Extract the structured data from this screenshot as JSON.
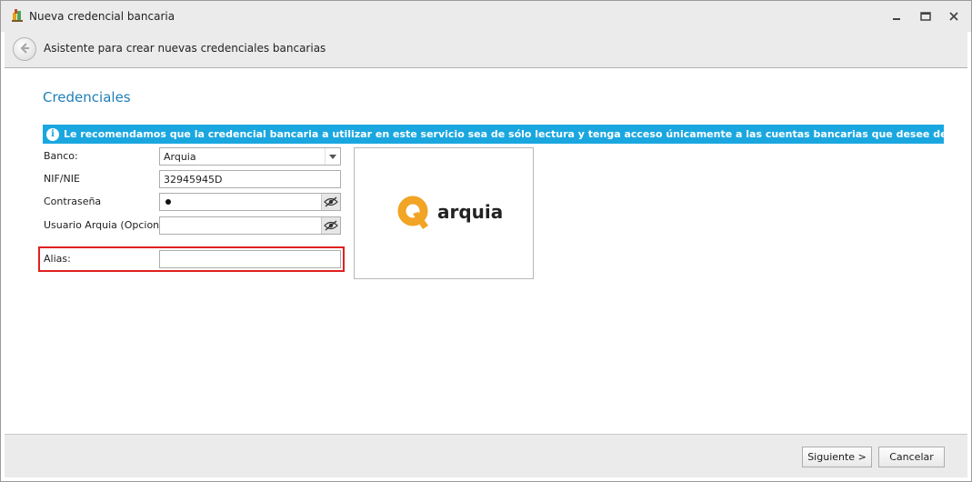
{
  "window": {
    "title": "Nueva credencial bancaria"
  },
  "header": {
    "title": "Asistente para crear nuevas credenciales bancarias"
  },
  "section": {
    "title": "Credenciales"
  },
  "banner": {
    "text": "Le recomendamos que la credencial bancaria a utilizar en este servicio sea de sólo lectura y tenga acceso únicamente a las cuentas bancarias que desee descargar.",
    "color": "#1aa7e0"
  },
  "form": {
    "bank_label": "Banco:",
    "bank_value": "Arquia",
    "nif_label": "NIF/NIE",
    "nif_value": "32945945D",
    "password_label": "Contraseña",
    "password_masked_count": 1,
    "user_label": "Usuario Arquia (Opcional)",
    "user_value": "",
    "alias_label": "Alias:",
    "alias_value": ""
  },
  "logo": {
    "text": "arquia",
    "accent": "#f2a424"
  },
  "footer": {
    "next_label": "Siguiente >",
    "cancel_label": "Cancelar"
  }
}
